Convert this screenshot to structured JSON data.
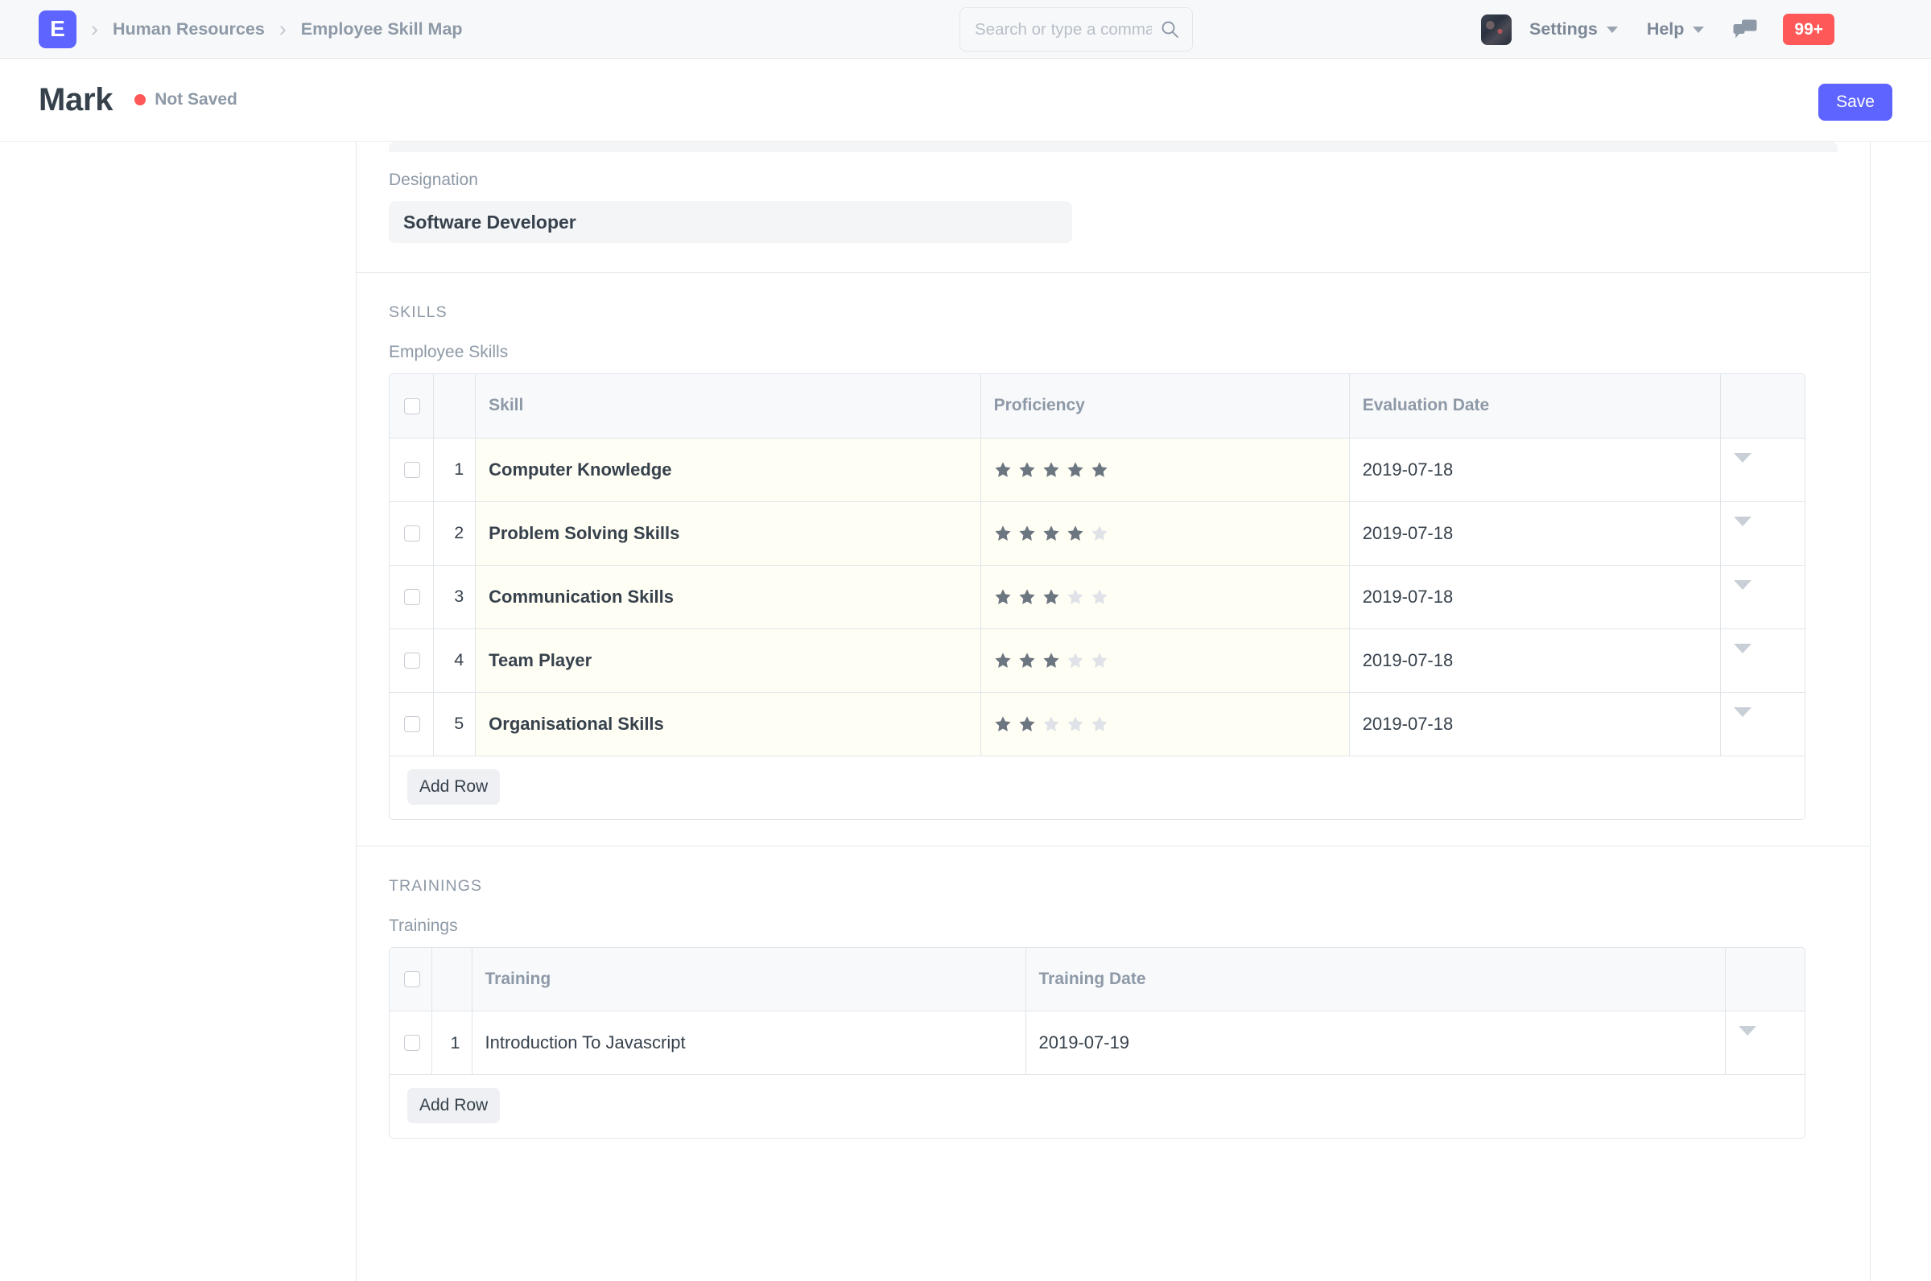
{
  "navbar": {
    "logo_letter": "E",
    "breadcrumbs": [
      "Human Resources",
      "Employee Skill Map"
    ],
    "search": {
      "value": "",
      "placeholder": "Search or type a command (Ctrl + G)"
    },
    "settings_label": "Settings",
    "help_label": "Help",
    "notification_count": "99+",
    "accent_color": "#5e64ff",
    "badge_color": "#ff5858"
  },
  "page_head": {
    "title": "Mark",
    "status_label": "Not Saved",
    "status_color": "#ff5858",
    "save_label": "Save"
  },
  "designation": {
    "label": "Designation",
    "value": "Software Developer"
  },
  "skills_section": {
    "section_title": "SKILLS",
    "grid_label": "Employee Skills",
    "columns": [
      "Skill",
      "Proficiency",
      "Evaluation Date"
    ],
    "rows": [
      {
        "idx": "1",
        "skill": "Computer Knowledge",
        "proficiency": 5,
        "evaluation_date": "2019-07-18"
      },
      {
        "idx": "2",
        "skill": "Problem Solving Skills",
        "proficiency": 4,
        "evaluation_date": "2019-07-18"
      },
      {
        "idx": "3",
        "skill": "Communication Skills",
        "proficiency": 3,
        "evaluation_date": "2019-07-18"
      },
      {
        "idx": "4",
        "skill": "Team Player",
        "proficiency": 3,
        "evaluation_date": "2019-07-18"
      },
      {
        "idx": "5",
        "skill": "Organisational Skills",
        "proficiency": 2,
        "evaluation_date": "2019-07-18"
      }
    ],
    "max_stars": 5,
    "add_row_label": "Add Row"
  },
  "trainings_section": {
    "section_title": "TRAININGS",
    "grid_label": "Trainings",
    "columns": [
      "Training",
      "Training Date"
    ],
    "rows": [
      {
        "idx": "1",
        "training": "Introduction To Javascript",
        "training_date": "2019-07-19"
      }
    ],
    "add_row_label": "Add Row"
  },
  "icons": {
    "search": "search-icon",
    "chat": "chat-icon",
    "caret": "chevron-down-icon",
    "star_filled": "star-filled-icon",
    "star_empty": "star-empty-icon"
  },
  "colors": {
    "star_filled": "#6c7680",
    "star_empty": "#dfe3e8",
    "dirty_cell": "#fffef5"
  }
}
